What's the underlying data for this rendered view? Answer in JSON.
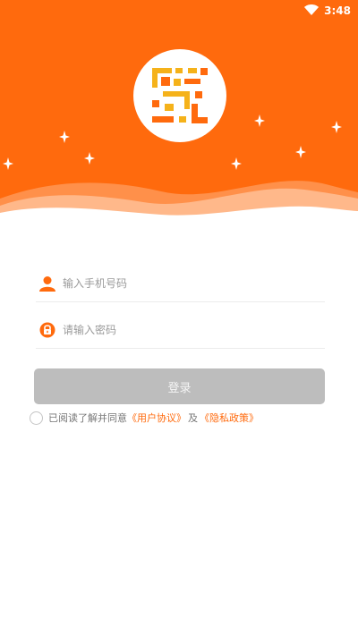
{
  "status_bar": {
    "time": "3:48"
  },
  "colors": {
    "brand": "#ff6a0d",
    "button_disabled": "#bdbdbd",
    "link": "#ff6a0d"
  },
  "form": {
    "phone_placeholder": "输入手机号码",
    "password_placeholder": "请输入密码",
    "login_label": "登录"
  },
  "agreement": {
    "prefix": "已阅读了解并同意",
    "user_agreement": "《用户协议》",
    "conjunction": "及",
    "privacy_policy": "《隐私政策》",
    "checked": false
  }
}
